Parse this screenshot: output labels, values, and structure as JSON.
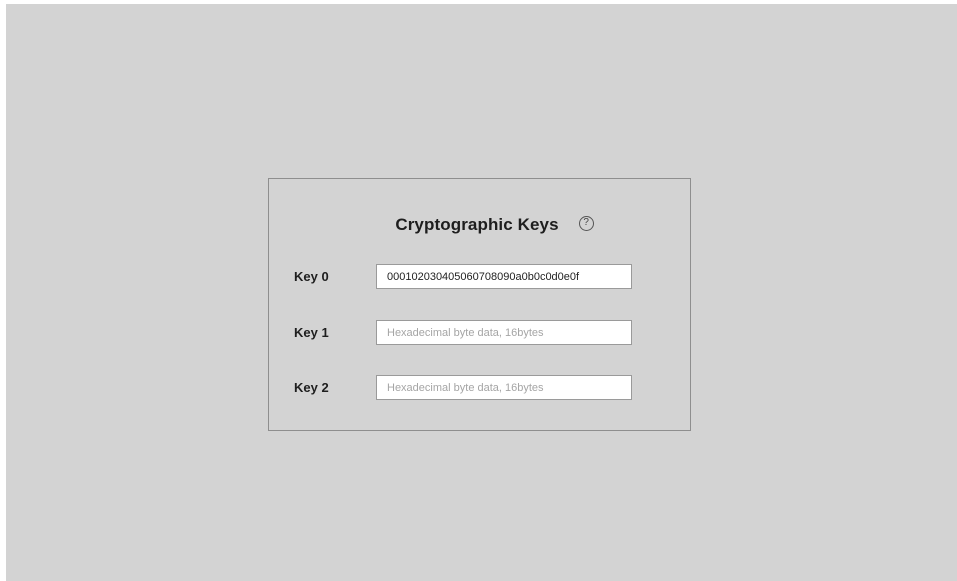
{
  "panel": {
    "title": "Cryptographic Keys",
    "help_icon": "question-circle-icon"
  },
  "keys": [
    {
      "label": "Key 0",
      "value": "000102030405060708090a0b0c0d0e0f",
      "placeholder": "Hexadecimal byte data, 16bytes"
    },
    {
      "label": "Key 1",
      "value": "",
      "placeholder": "Hexadecimal byte data, 16bytes"
    },
    {
      "label": "Key 2",
      "value": "",
      "placeholder": "Hexadecimal byte data, 16bytes"
    }
  ]
}
